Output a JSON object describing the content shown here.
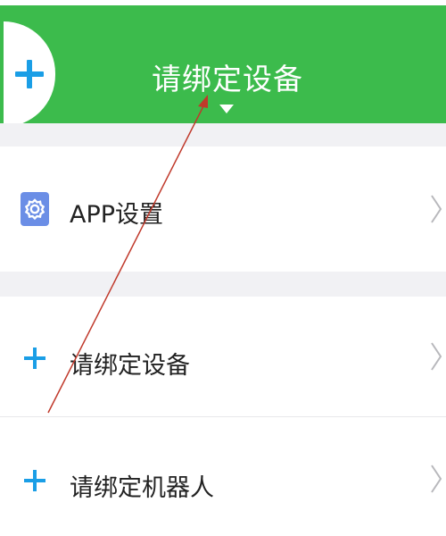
{
  "header": {
    "title": "请绑定设备",
    "add_icon": "plus-icon",
    "dropdown_icon": "caret-down-icon",
    "background_color": "#3cbb4c",
    "title_color": "#ffffff"
  },
  "menu": {
    "items": [
      {
        "label": "APP设置",
        "icon": "gear-icon",
        "icon_color": "#6b8ee6",
        "chevron": "chevron-right-icon"
      },
      {
        "label": "请绑定设备",
        "icon": "plus-icon",
        "icon_color": "#1a9ee6",
        "chevron": "chevron-right-icon"
      },
      {
        "label": "请绑定机器人",
        "icon": "plus-icon",
        "icon_color": "#1a9ee6",
        "chevron": "chevron-right-icon"
      }
    ]
  },
  "annotation": {
    "type": "arrow",
    "color": "#c0392b"
  }
}
